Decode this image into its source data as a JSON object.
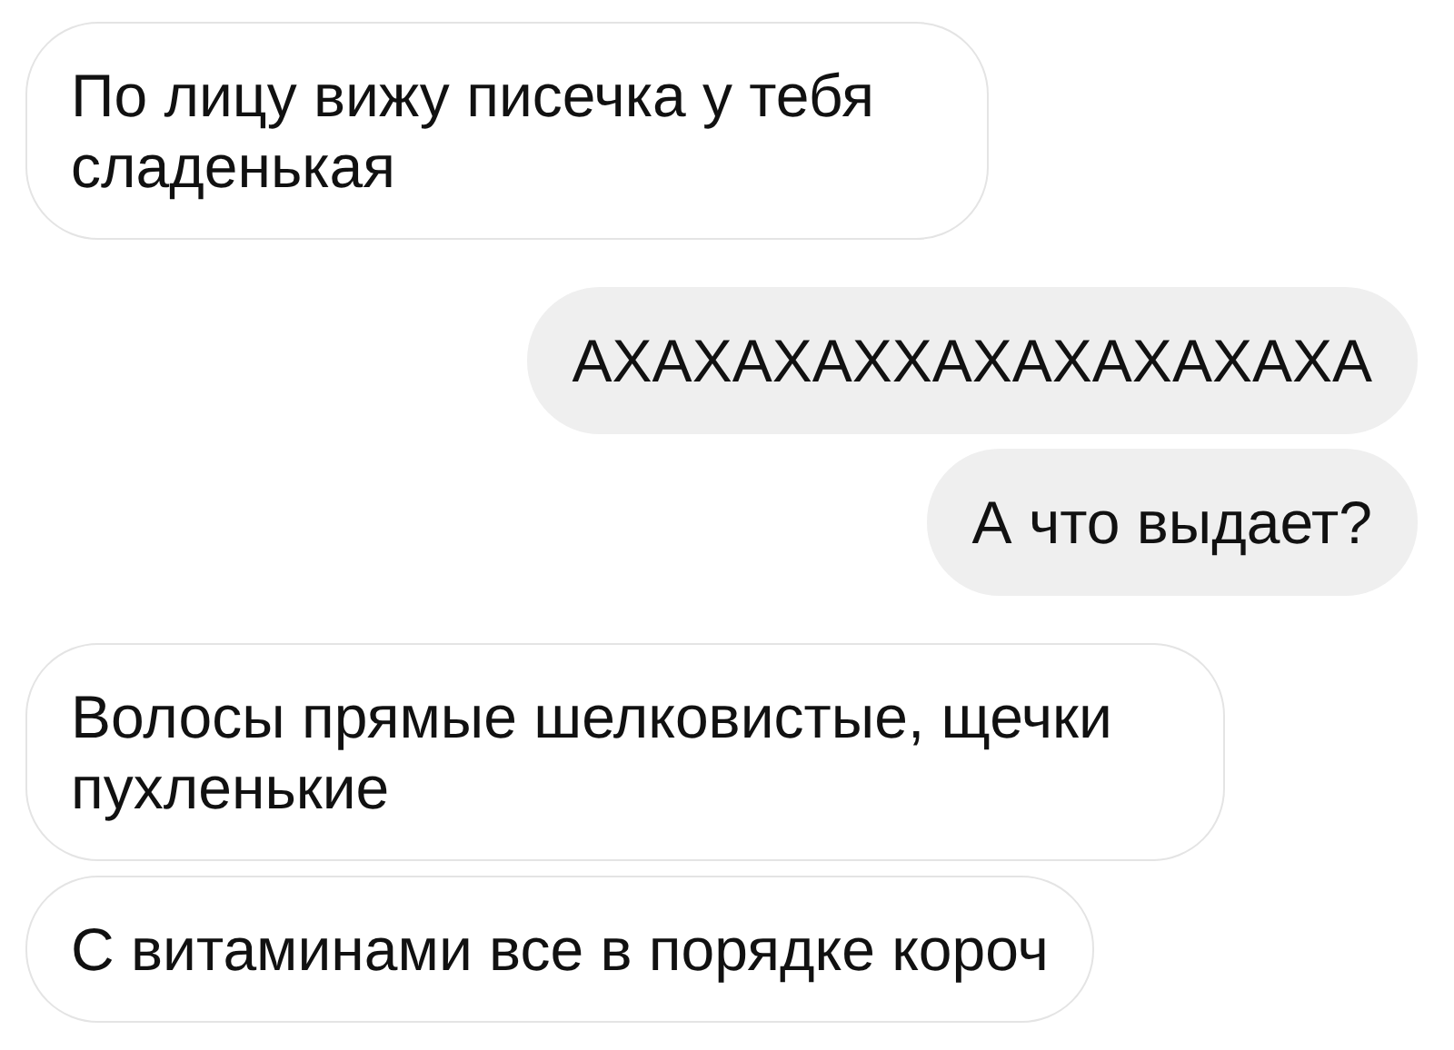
{
  "messages": [
    {
      "kind": "incoming",
      "text": "По лицу вижу писечка у тебя сладенькая"
    },
    {
      "kind": "outgoing",
      "text": "АХАХАХАХХАХАХАХАХАХА"
    },
    {
      "kind": "outgoing",
      "text": "А что выдает?"
    },
    {
      "kind": "incoming",
      "text": "Волосы прямые шелковистые, щечки пухленькие"
    },
    {
      "kind": "incoming",
      "text": "С витаминами все в порядке короч"
    }
  ]
}
